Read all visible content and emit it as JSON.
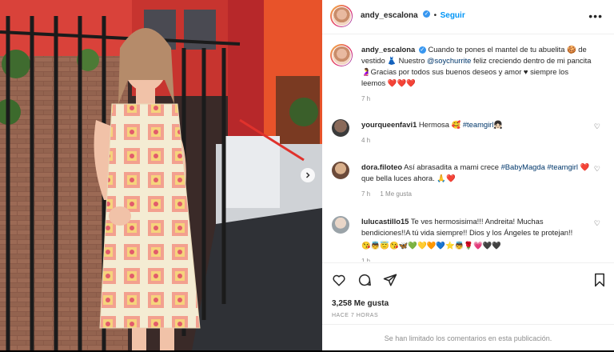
{
  "post": {
    "author": "andy_escalona",
    "follow_label": "Seguir",
    "more_label": "•••",
    "caption_body": "Cuando te pones el mantel de tu abuelita 🍪 de vestido 👗 Nuestro",
    "caption_mention": "@soychurrite",
    "caption_rest": "feliz creciendo dentro de mi pancita 🤰Gracias por todos sus buenos deseos y amor ♥ siempre los leemos",
    "caption_hearts": "❤️❤️❤️",
    "caption_time": "7 h",
    "likes": "3,258 Me gusta",
    "time_ago": "HACE 7 HORAS",
    "comments_limited": "Se han limitado los comentarios en esta publicación."
  },
  "comments": [
    {
      "user": "yourqueenfavi1",
      "text": "Hermosa 🥰",
      "tag": "#teamgirl",
      "emoji_after": "👧🏻",
      "time": "4 h",
      "likes": ""
    },
    {
      "user": "dora.filoteo",
      "text": "Así abrasadita a mami crece",
      "tag": "#BabyMagda",
      "tag2": "#teamgirl",
      "text2": "❤️ que bella luces ahora. 🙏❤️",
      "time": "7 h",
      "likes": "1 Me gusta"
    },
    {
      "user": "lulucastillo15",
      "text": "Te ves hermosisima!!! Andreita! Muchas bendiciones!!A tú vida siempre!! Dios y los Ángeles te protejan!!",
      "emojis": "😘👼😇😘🦋💚💛🧡💙⭐👼🌹💗🖤🖤",
      "time": "1 h"
    }
  ],
  "colors": {
    "link": "#00376b",
    "follow": "#0095f6",
    "wall": "#e8532a",
    "dress_pink": "#f08a7a",
    "dress_cream": "#f4ecd3"
  }
}
